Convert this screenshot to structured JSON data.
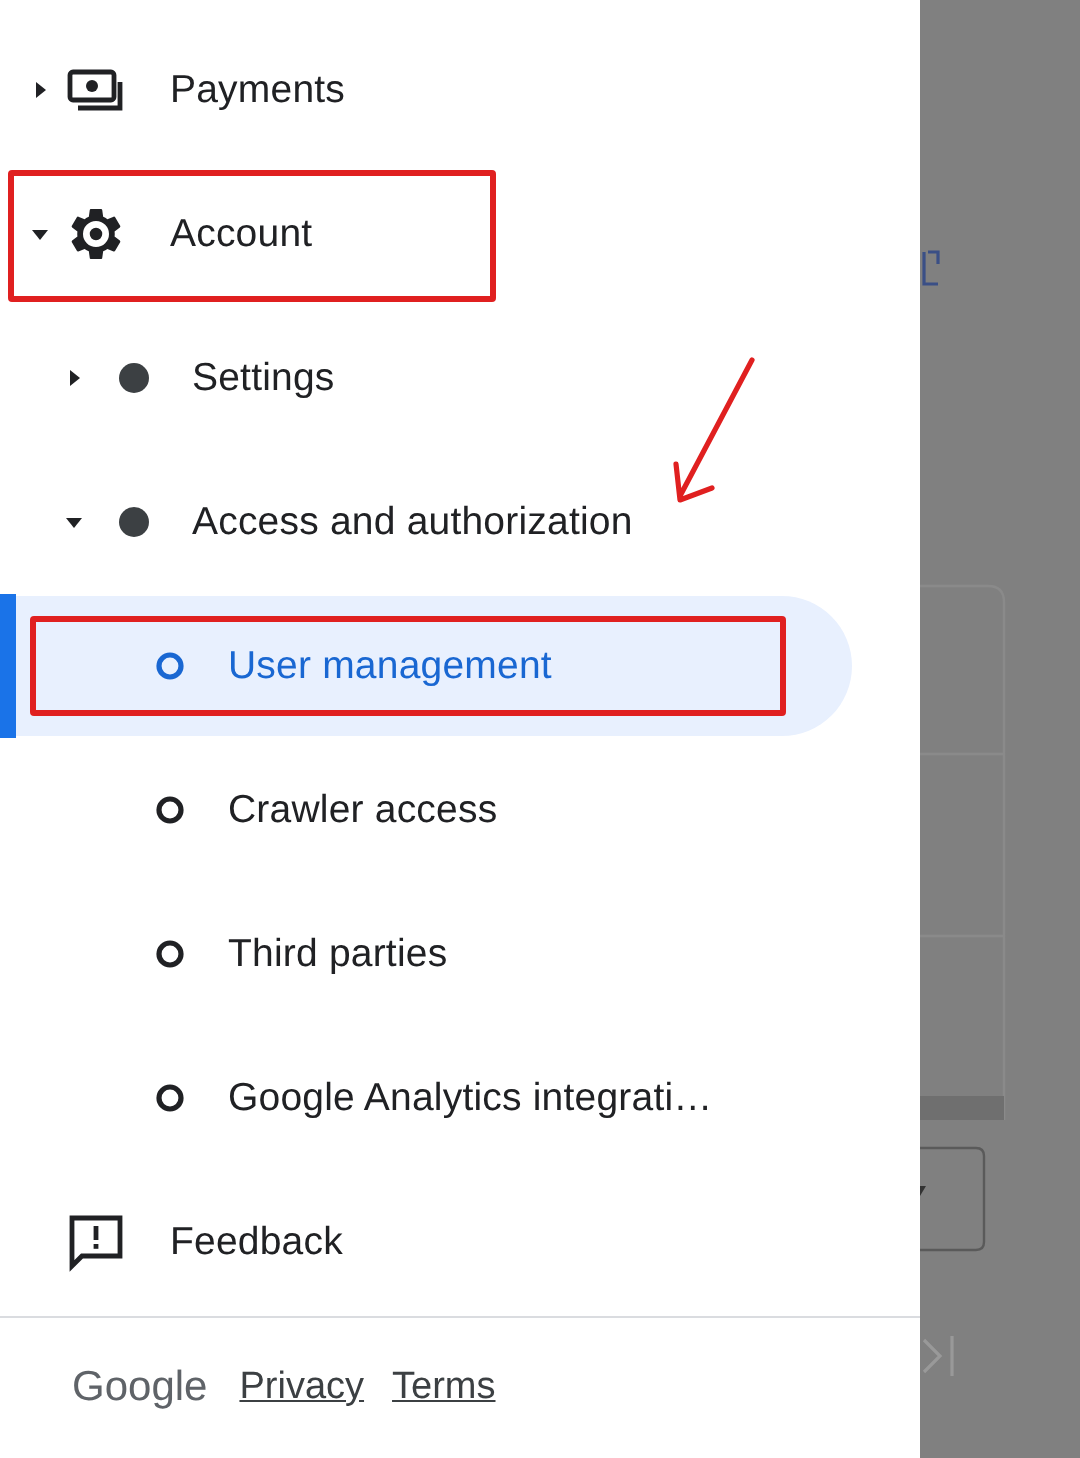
{
  "nav": [
    {
      "label": "Payments",
      "kind": "payments",
      "expanded": false,
      "selected": false,
      "highlighted": false
    },
    {
      "label": "Account",
      "kind": "settings",
      "expanded": true,
      "selected": false,
      "highlighted": true,
      "children": [
        {
          "label": "Settings",
          "expanded": false,
          "selected": false,
          "highlighted": false
        },
        {
          "label": "Access and authorization",
          "expanded": true,
          "selected": false,
          "highlighted": false,
          "children": [
            {
              "label": "User management",
              "selected": true,
              "highlighted": true
            },
            {
              "label": "Crawler access",
              "selected": false,
              "highlighted": false
            },
            {
              "label": "Third parties",
              "selected": false,
              "highlighted": false
            },
            {
              "label": "Google Analytics integrati…",
              "selected": false,
              "highlighted": false
            }
          ]
        }
      ]
    },
    {
      "label": "Feedback",
      "kind": "feedback",
      "selected": false,
      "highlighted": false
    }
  ],
  "footer": {
    "logo": "Google",
    "links": [
      "Privacy",
      "Terms"
    ]
  }
}
